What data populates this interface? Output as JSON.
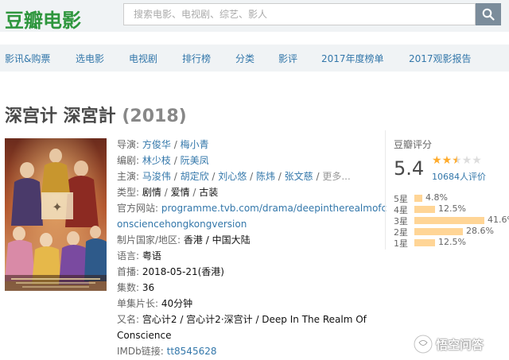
{
  "header": {
    "logo_text": "豆瓣电影",
    "search_placeholder": "搜索电影、电视剧、综艺、影人",
    "brand_color": "#2e963d"
  },
  "nav": {
    "items": [
      "影讯&购票",
      "选电影",
      "电视剧",
      "排行榜",
      "分类",
      "影评",
      "2017年度榜单",
      "2017观影报告"
    ],
    "link_color": "#3377aa"
  },
  "movie": {
    "title": "深宫计 深宮計",
    "year": "(2018)",
    "director_label": "导演:",
    "directors": [
      "方俊华",
      "梅小青"
    ],
    "writer_label": "编剧:",
    "writers": [
      "林少枝",
      "阮美凤"
    ],
    "cast_label": "主演:",
    "cast": [
      "马浚伟",
      "胡定欣",
      "刘心悠",
      "陈炜",
      "张文慈"
    ],
    "cast_more": "更多...",
    "genre_label": "类型:",
    "genres": [
      "剧情",
      "爱情",
      "古装"
    ],
    "site_label": "官方网站:",
    "site_line1": "programme.tvb.com/drama/deepintherealmofc",
    "site_line2": "onsciencehongkongversion",
    "region_label": "制片国家/地区:",
    "region": "香港 / 中国大陆",
    "language_label": "语言:",
    "language": "粤语",
    "release_label": "首播:",
    "release": "2018-05-21(香港)",
    "episodes_label": "集数:",
    "episodes": "36",
    "runtime_label": "单集片长:",
    "runtime": "40分钟",
    "aka_label": "又名:",
    "aka_line1": "宫心计2 / 宫心计2·深宫计 / Deep In The Realm Of",
    "aka_line2": "Conscience",
    "imdb_label": "IMDb链接:",
    "imdb": "tt8545628"
  },
  "rating": {
    "label": "豆瓣评分",
    "score": "5.4",
    "stars_filled": 2.5,
    "votes": "10684人评价",
    "rows": [
      {
        "label": "5星",
        "percent": 4.8,
        "text": "4.8%"
      },
      {
        "label": "4星",
        "percent": 12.5,
        "text": "12.5%"
      },
      {
        "label": "3星",
        "percent": 41.6,
        "text": "41.6%"
      },
      {
        "label": "2星",
        "percent": 28.6,
        "text": "28.6%"
      },
      {
        "label": "1星",
        "percent": 12.5,
        "text": "12.5%"
      }
    ]
  },
  "watermark": {
    "text": "悟空问答"
  }
}
